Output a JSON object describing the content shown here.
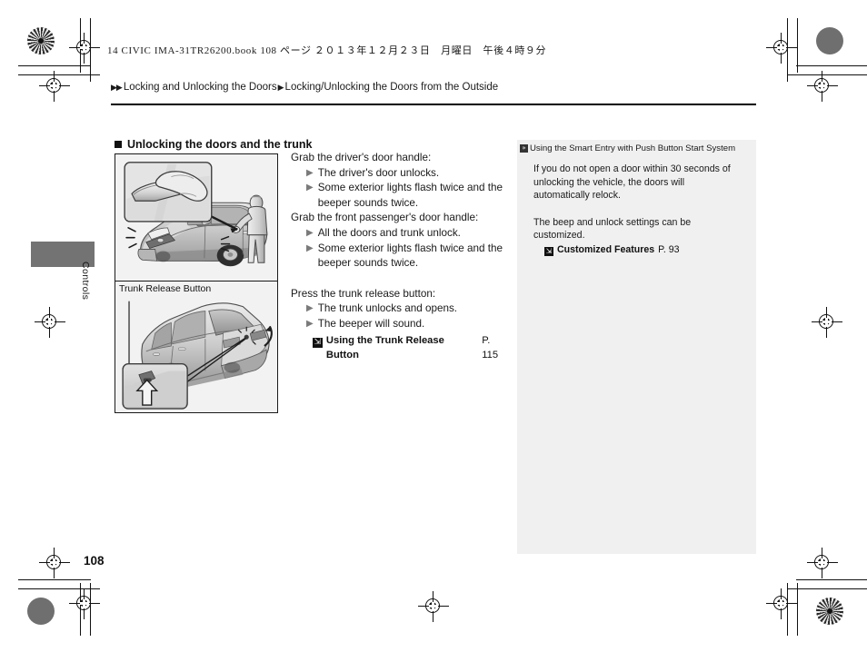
{
  "sheet": {
    "print_header": "14 CIVIC IMA-31TR26200.book  108 ページ  ２０１３年１２月２３日　月曜日　午後４時９分",
    "page_number": "108"
  },
  "breadcrumb": {
    "double_arrow_icon": "double-right-arrow-icon",
    "level1": "Locking and Unlocking the Doors",
    "separator_icon": "right-arrow-icon",
    "level2": "Locking/Unlocking the Doors from the Outside"
  },
  "chapter_tab": {
    "label": "Controls",
    "color": "#737373"
  },
  "section": {
    "bullet_icon": "square-bullet-icon",
    "title": "Unlocking the doors and the trunk"
  },
  "figures": [
    {
      "name": "unlocking-doors-illustration",
      "caption": ""
    },
    {
      "name": "trunk-release-button-illustration",
      "caption": "Trunk Release Button"
    }
  ],
  "body": {
    "blocks": [
      {
        "lead": "Grab the driver's door handle:",
        "bullets": [
          "The driver's door unlocks.",
          "Some exterior lights flash twice and the beeper sounds twice."
        ]
      },
      {
        "lead": "Grab the front passenger's door handle:",
        "bullets": [
          "All the doors and trunk unlock.",
          "Some exterior lights flash twice and the beeper sounds twice."
        ]
      },
      {
        "lead": "Press the trunk release button:",
        "bullets": [
          "The trunk unlocks and opens.",
          "The beeper will sound."
        ],
        "xref": {
          "icon": "page-reference-icon",
          "title": "Using the Trunk Release Button",
          "page": "P. 115"
        }
      }
    ],
    "bullet_icon": "right-triangle-icon"
  },
  "info_panel": {
    "header_icon": "note-marker-icon",
    "header": "Using the Smart Entry with Push Button Start System",
    "paragraph1": "If you do not open a door within 30 seconds of unlocking the vehicle, the doors will automatically relock.",
    "paragraph2": "The beep and unlock settings can be customized.",
    "xref": {
      "icon": "page-reference-icon",
      "title": "Customized Features",
      "page": "P. 93"
    },
    "background": "#f0f0f0"
  }
}
